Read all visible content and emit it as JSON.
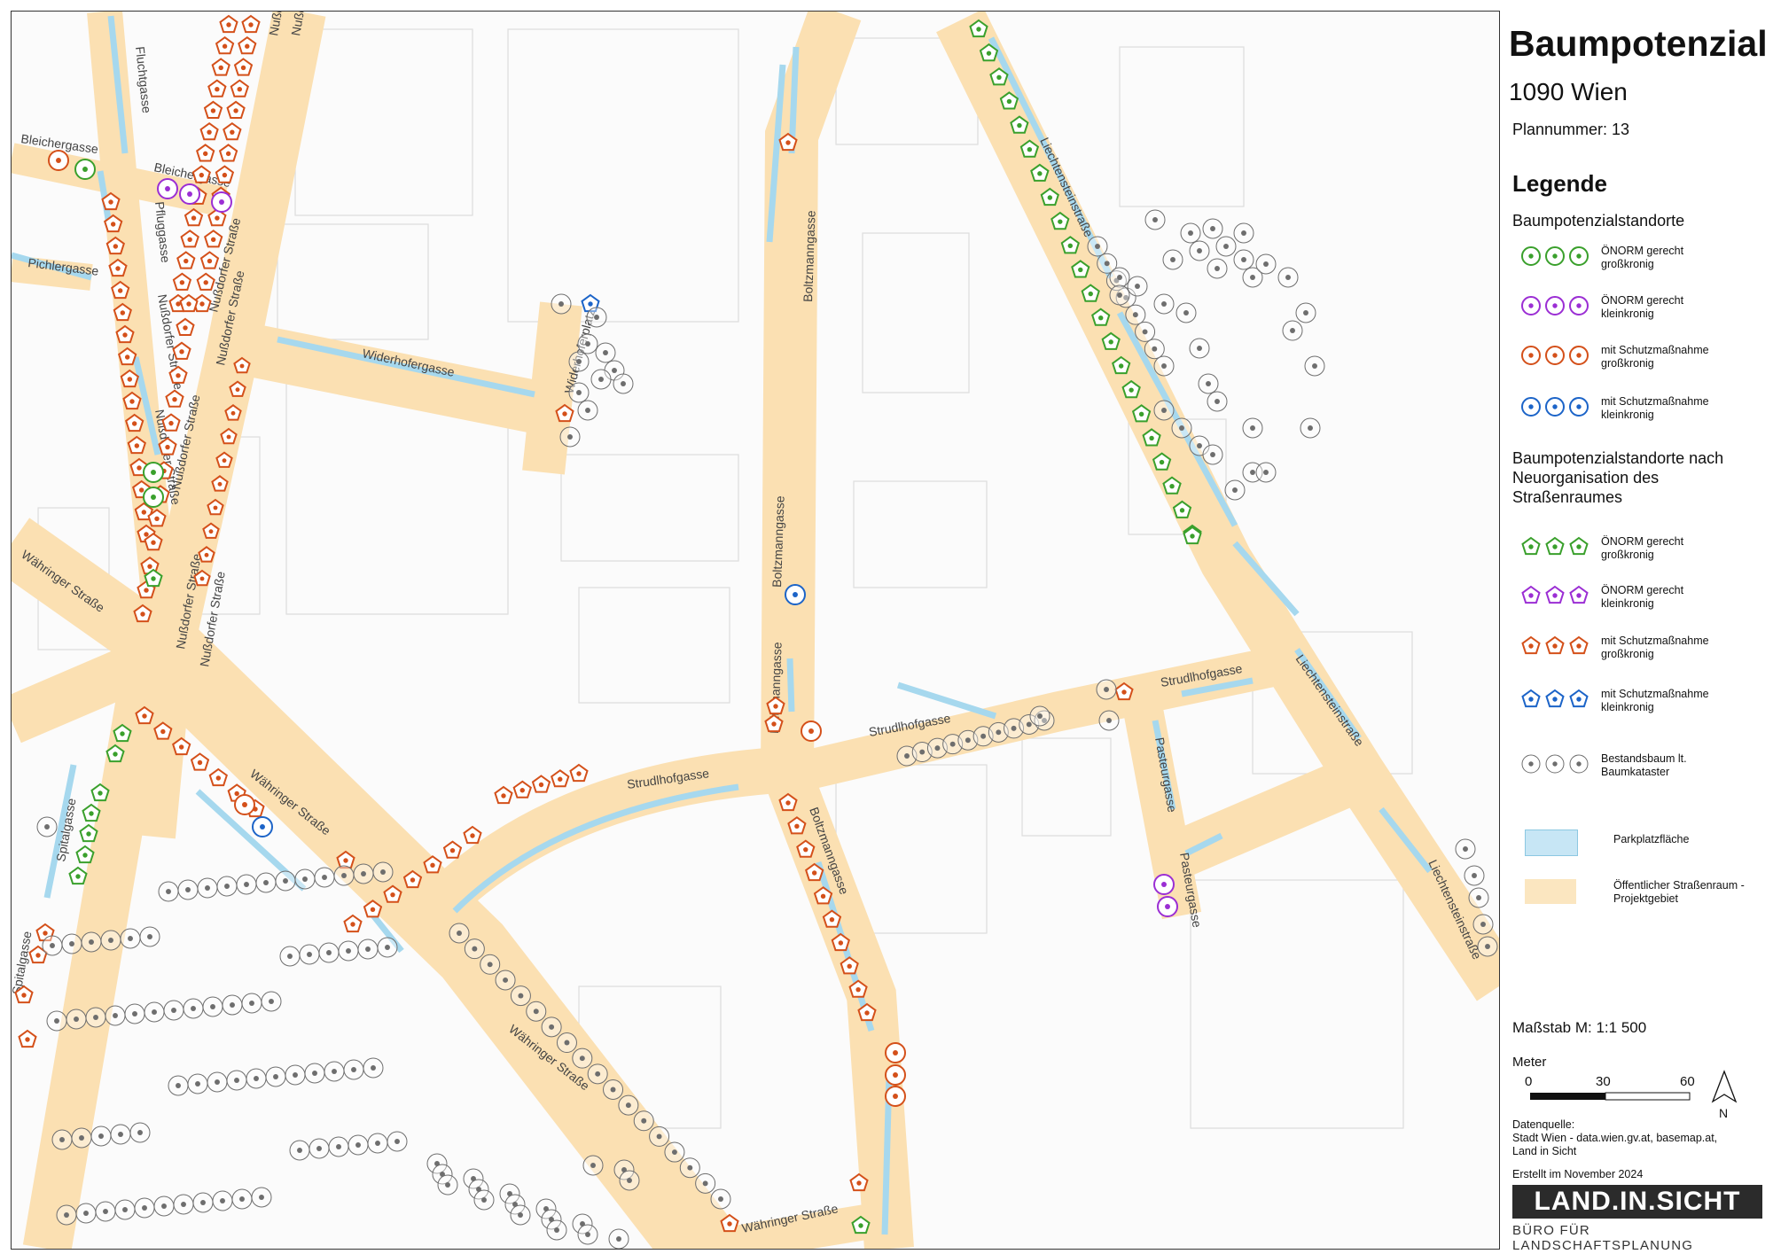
{
  "map": {
    "streets": [
      "Fluchtgasse",
      "Nußdorfer Straße",
      "Nußdorfer Straße",
      "Bleichergasse",
      "Bleichergasse",
      "Pfluggasse",
      "Pichlergasse",
      "Nußdorfer Straße",
      "Nußdorfer Straße",
      "Nußdorfer Straße",
      "Nußdorfer Straße",
      "Nußdorfer Straße",
      "Nußdorfer Straße",
      "Nußdorfer Straße",
      "Widerhoferplatz",
      "Widerhofergasse",
      "Boltzmanngasse",
      "Boltzmanngasse",
      "Boltzmanngasse",
      "Boltzmanngasse",
      "Liechtensteinstraße",
      "Liechtensteinstraße",
      "Liechtensteinstraße",
      "Währinger Straße",
      "Währinger Straße",
      "Währinger Straße",
      "Währinger Straße",
      "Spitalgasse",
      "Spitalgasse",
      "Strudlhofgasse",
      "Strudlhofgasse",
      "Strudlhofgasse",
      "Pasteurgasse",
      "Pasteurgasse"
    ]
  },
  "panel": {
    "title": "Baumpotenzial",
    "subtitle": "1090 Wien",
    "plannummer": "Plannummer: 13",
    "legend_heading": "Legende",
    "section1": "Baumpotenzialstandorte",
    "section2": "Baumpotenzialstandorte nach Neuorganisation des Straßenraumes",
    "items": [
      {
        "label1": "ÖNORM gerecht",
        "label2": "großkronig",
        "color": "#3aa02c",
        "shape": "circle"
      },
      {
        "label1": "ÖNORM gerecht",
        "label2": "kleinkronig",
        "color": "#9b2ed4",
        "shape": "circle"
      },
      {
        "label1": "mit Schutzmaßnahme",
        "label2": "großkronig",
        "color": "#d4501a",
        "shape": "circle"
      },
      {
        "label1": "mit Schutzmaßnahme",
        "label2": "kleinkronig",
        "color": "#1c64c8",
        "shape": "circle"
      },
      {
        "label1": "ÖNORM gerecht",
        "label2": "großkronig",
        "color": "#3aa02c",
        "shape": "pentagon"
      },
      {
        "label1": "ÖNORM gerecht",
        "label2": "kleinkronig",
        "color": "#9b2ed4",
        "shape": "pentagon"
      },
      {
        "label1": "mit Schutzmaßnahme",
        "label2": "großkronig",
        "color": "#d4501a",
        "shape": "pentagon"
      },
      {
        "label1": "mit Schutzmaßnahme",
        "label2": "kleinkronig",
        "color": "#1c64c8",
        "shape": "pentagon"
      },
      {
        "label1": "Bestandsbaum lt.",
        "label2": "Baumkataster",
        "color": "#6e6e6e",
        "shape": "circle"
      }
    ],
    "area_parking": "Parkplatzfläche",
    "area_public1": "Öffentlicher Straßenraum -",
    "area_public2": "Projektgebiet",
    "colors": {
      "parking": "#c7e6f5",
      "public": "#fbe6c0"
    },
    "scale": "Maßstab M: 1:1 500",
    "meter": "Meter",
    "scale_ticks": [
      "0",
      "30",
      "60"
    ],
    "north": "N",
    "source1": "Datenquelle:",
    "source2": "Stadt Wien - data.wien.gv.at, basemap.at,",
    "source3": "Land in Sicht",
    "created": "Erstellt im November 2024",
    "logo": "LAND.IN.SICHT",
    "logo_sub": "BÜRO FÜR LANDSCHAFTSPLANUNG"
  }
}
